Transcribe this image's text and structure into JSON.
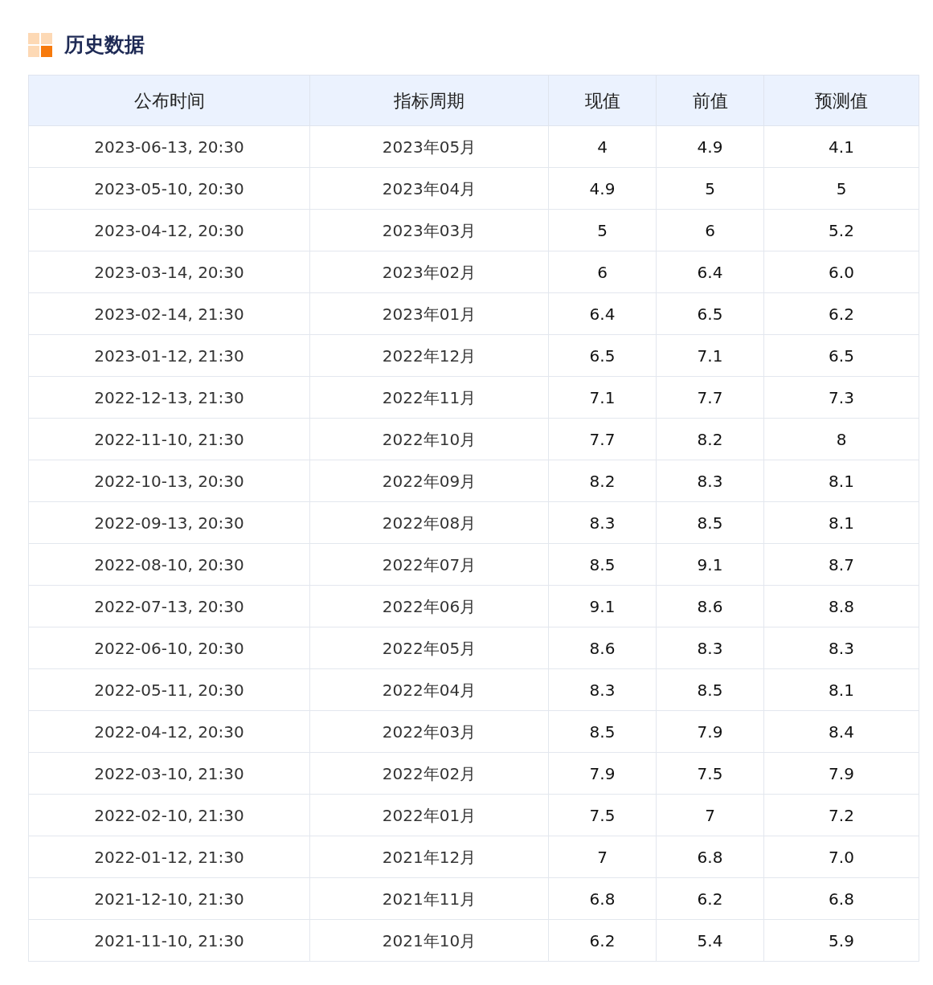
{
  "section": {
    "title": "历史数据"
  },
  "table": {
    "columns": [
      "公布时间",
      "指标周期",
      "现值",
      "前值",
      "预测值"
    ],
    "rows": [
      [
        "2023-06-13, 20:30",
        "2023年05月",
        "4",
        "4.9",
        "4.1"
      ],
      [
        "2023-05-10, 20:30",
        "2023年04月",
        "4.9",
        "5",
        "5"
      ],
      [
        "2023-04-12, 20:30",
        "2023年03月",
        "5",
        "6",
        "5.2"
      ],
      [
        "2023-03-14, 20:30",
        "2023年02月",
        "6",
        "6.4",
        "6.0"
      ],
      [
        "2023-02-14, 21:30",
        "2023年01月",
        "6.4",
        "6.5",
        "6.2"
      ],
      [
        "2023-01-12, 21:30",
        "2022年12月",
        "6.5",
        "7.1",
        "6.5"
      ],
      [
        "2022-12-13, 21:30",
        "2022年11月",
        "7.1",
        "7.7",
        "7.3"
      ],
      [
        "2022-11-10, 21:30",
        "2022年10月",
        "7.7",
        "8.2",
        "8"
      ],
      [
        "2022-10-13, 20:30",
        "2022年09月",
        "8.2",
        "8.3",
        "8.1"
      ],
      [
        "2022-09-13, 20:30",
        "2022年08月",
        "8.3",
        "8.5",
        "8.1"
      ],
      [
        "2022-08-10, 20:30",
        "2022年07月",
        "8.5",
        "9.1",
        "8.7"
      ],
      [
        "2022-07-13, 20:30",
        "2022年06月",
        "9.1",
        "8.6",
        "8.8"
      ],
      [
        "2022-06-10, 20:30",
        "2022年05月",
        "8.6",
        "8.3",
        "8.3"
      ],
      [
        "2022-05-11, 20:30",
        "2022年04月",
        "8.3",
        "8.5",
        "8.1"
      ],
      [
        "2022-04-12, 20:30",
        "2022年03月",
        "8.5",
        "7.9",
        "8.4"
      ],
      [
        "2022-03-10, 21:30",
        "2022年02月",
        "7.9",
        "7.5",
        "7.9"
      ],
      [
        "2022-02-10, 21:30",
        "2022年01月",
        "7.5",
        "7",
        "7.2"
      ],
      [
        "2022-01-12, 21:30",
        "2021年12月",
        "7",
        "6.8",
        "7.0"
      ],
      [
        "2021-12-10, 21:30",
        "2021年11月",
        "6.8",
        "6.2",
        "6.8"
      ],
      [
        "2021-11-10, 21:30",
        "2021年10月",
        "6.2",
        "5.4",
        "5.9"
      ]
    ]
  }
}
